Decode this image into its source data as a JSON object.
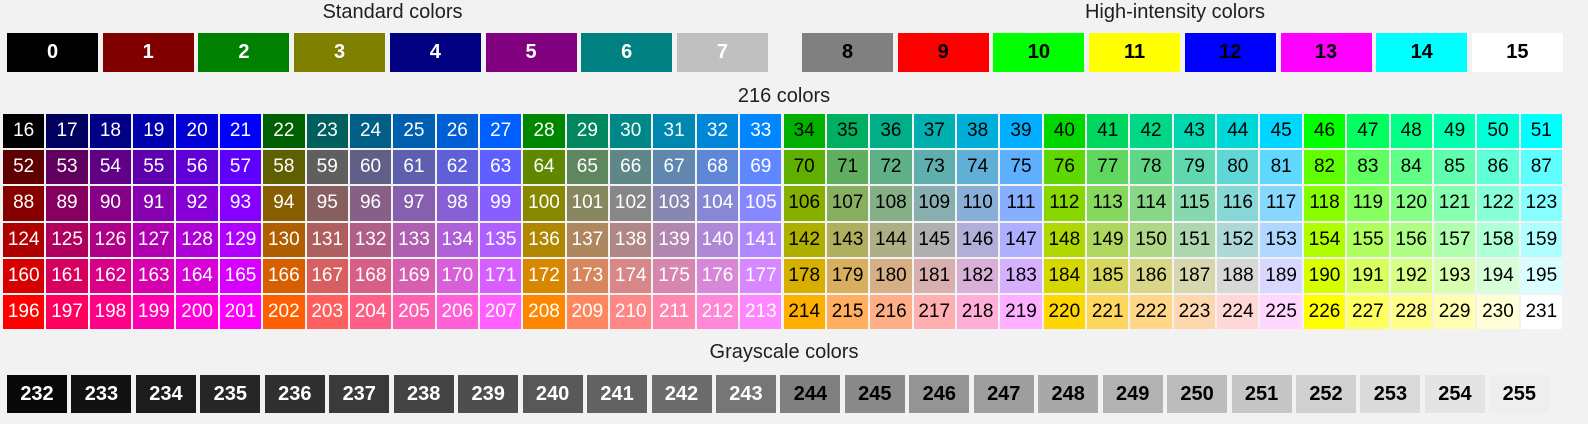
{
  "headings": {
    "standard": "Standard colors",
    "high_intensity": "High-intensity colors",
    "cube": "216 colors",
    "grayscale": "Grayscale colors"
  },
  "standard_colors": [
    {
      "label": "0",
      "color": "#000000",
      "text_color": "#ffffff"
    },
    {
      "label": "1",
      "color": "#800000",
      "text_color": "#ffffff"
    },
    {
      "label": "2",
      "color": "#008000",
      "text_color": "#ffffff"
    },
    {
      "label": "3",
      "color": "#808000",
      "text_color": "#ffffff"
    },
    {
      "label": "4",
      "color": "#000080",
      "text_color": "#ffffff"
    },
    {
      "label": "5",
      "color": "#800080",
      "text_color": "#ffffff"
    },
    {
      "label": "6",
      "color": "#008080",
      "text_color": "#ffffff"
    },
    {
      "label": "7",
      "color": "#c0c0c0",
      "text_color": "#ffffff"
    }
  ],
  "high_intensity_colors": [
    {
      "label": "8",
      "color": "#808080",
      "text_color": "#000000"
    },
    {
      "label": "9",
      "color": "#ff0000",
      "text_color": "#000000"
    },
    {
      "label": "10",
      "color": "#00ff00",
      "text_color": "#000000"
    },
    {
      "label": "11",
      "color": "#ffff00",
      "text_color": "#000000"
    },
    {
      "label": "12",
      "color": "#0000ff",
      "text_color": "#000000"
    },
    {
      "label": "13",
      "color": "#ff00ff",
      "text_color": "#000000"
    },
    {
      "label": "14",
      "color": "#00ffff",
      "text_color": "#000000"
    },
    {
      "label": "15",
      "color": "#ffffff",
      "text_color": "#000000"
    }
  ],
  "cube": {
    "first_label": 16,
    "levels": [
      0,
      95,
      135,
      175,
      215,
      255
    ],
    "light_text_color": "#ffffff",
    "dark_text_color": "#000000"
  },
  "grayscale": {
    "first_label": 232,
    "first_level": 8,
    "step": 10,
    "light_text_color": "#ffffff",
    "dark_text_color": "#000000"
  }
}
